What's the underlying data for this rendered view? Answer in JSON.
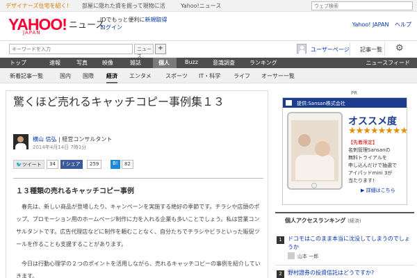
{
  "promo": {
    "left": "デザイナーズ住宅を紹く！",
    "middle": "部屋に隠れた資を掘って現物に活",
    "right": "Yahoo!ニュース",
    "search_placeholder": "ウェブ検索"
  },
  "header": {
    "logo": "YAHOO!",
    "logo_sub": "JAPAN",
    "news_label": "ニュース",
    "login_line1": "IDでもっと便利に",
    "login_register": "新規取得",
    "login_link": "ログイン",
    "right_links": [
      "Yahoo! JAPAN",
      "ヘルプ"
    ]
  },
  "search": {
    "placeholder": "キーワードを入力",
    "scope": "ニュース",
    "add_label": "+",
    "user_page": "ユーザーページ",
    "list_label": "記事一覧",
    "icons": {
      "settings": "gear-icon",
      "user": "user-avatar-icon"
    }
  },
  "nav": {
    "items": [
      "トップ",
      "速報",
      "写真",
      "映像",
      "雑誌",
      "個人",
      "Buzz",
      "意識調査",
      "ランキング"
    ],
    "active_index": 5,
    "feed": "ニュースフィード"
  },
  "subnav": {
    "items": [
      "新着記事一覧",
      "国内",
      "国際",
      "経済",
      "エンタメ",
      "スポーツ",
      "IT・科学",
      "ライフ",
      "オーサー一覧"
    ],
    "active_index": 3
  },
  "article": {
    "title": "驚くほど売れるキャッチコピー事例集１３",
    "author_name": "横山 信弘",
    "author_role": "経営コンサルタント",
    "date": "2014年4月14日 7時1分",
    "share": {
      "twitter": "ツイート",
      "twitter_count": "34",
      "facebook": "シェア",
      "facebook_count": "259",
      "hatena": "B!",
      "hatena_count": "82"
    },
    "subheading": "１３種類の売れるキャッチコピー事例",
    "paragraphs": [
      "春先は、新しい商品が登場したり、キャンペーンを実施する絶好の季節です。チラシや店頭のポップ、プロモーション用のホームページ制作に力を入れる企業も多いことでしょう。私は営業コンサルタントです。広告代理店などに制作を頼むことなく、自分たちでチラシやビラといった販促ツールを作ることも支援することがあります。",
      "今日は行動心理学の２つのポイントを活用しながら、売れるキャッチコピーの事例を紹介していきます。"
    ]
  },
  "sidebar": {
    "pr": "PR",
    "ad": {
      "header": "提供:Sansan株式会社",
      "headline": "オススメ度",
      "stars": "★★★★★★★★",
      "lines": [
        "【先着限定】",
        "名刺管理Sansanの",
        "無料トライアルを",
        "申し込んだけで抽選で",
        "アイパッドmini 3が",
        "当たります!"
      ],
      "detail": "▶ 詳細はこちら"
    },
    "ranking": {
      "title": "個人アクセスランキング",
      "subtitle": "(経済)",
      "items": [
        {
          "rank": "1",
          "text": "ドコモはこのまま本当に沈没してしまうのでしょうか",
          "author": "山本 一郎"
        },
        {
          "rank": "2",
          "text": "野村證券の投資信託はどうですか?"
        }
      ]
    }
  }
}
